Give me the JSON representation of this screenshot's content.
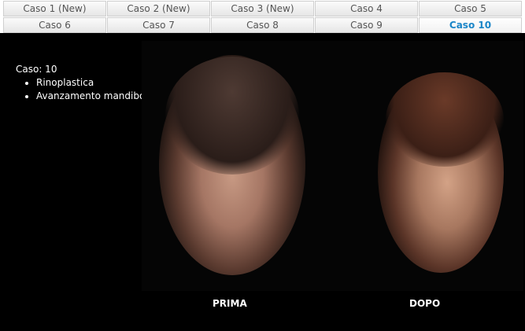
{
  "tabs": {
    "row1": [
      "Caso 1 (New)",
      "Caso 2 (New)",
      "Caso 3 (New)",
      "Caso 4",
      "Caso 5"
    ],
    "row2": [
      "Caso 6",
      "Caso 7",
      "Caso 8",
      "Caso 9",
      "Caso 10"
    ],
    "active": "Caso 10"
  },
  "case": {
    "label": "Caso: 10",
    "procedures": [
      "Rinoplastica",
      "Avanzamento mandibolare"
    ]
  },
  "photos": {
    "before_caption": "PRIMA",
    "after_caption": "DOPO"
  },
  "colors": {
    "active_tab": "#1b86c8",
    "background": "#000000"
  }
}
